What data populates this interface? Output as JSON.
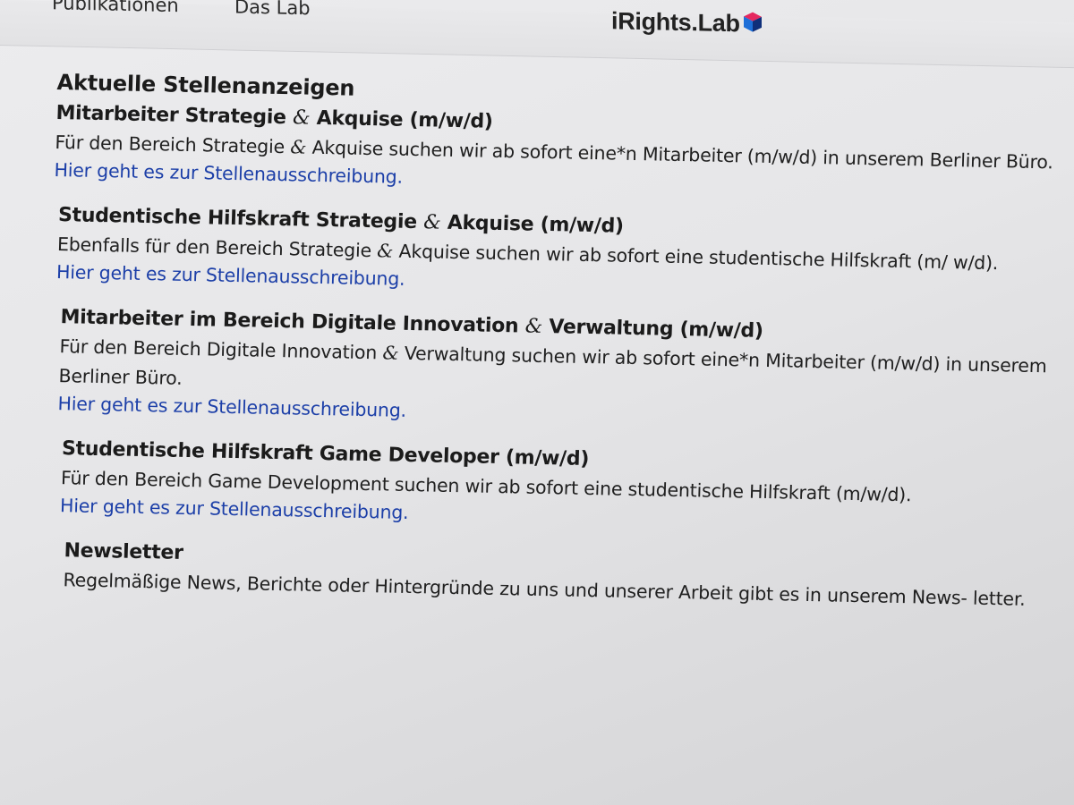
{
  "nav": {
    "items": [
      "Publikationen",
      "Das Lab"
    ],
    "logo_text": "iRights.Lab"
  },
  "section_title": "Aktuelle Stellenanzeigen",
  "jobs": [
    {
      "title_a": "Mitarbeiter Strategie ",
      "amp": "&",
      "title_b": " Akquise (m/w/d)",
      "desc_a": "Für den Bereich Strategie ",
      "desc_amp": "&",
      "desc_b": " Akquise suchen wir ab sofort eine*n Mitarbeiter (m/w/d) in unserem Berliner Büro.",
      "link": "Hier geht es zur Stellenausschreibung."
    },
    {
      "title_a": "Studentische Hilfskraft Strategie ",
      "amp": "&",
      "title_b": " Akquise (m/w/d)",
      "desc_a": "Ebenfalls für den Bereich Strategie ",
      "desc_amp": "&",
      "desc_b": " Akquise suchen wir ab sofort eine studentische Hilfskraft (m/ w/d).",
      "link": "Hier geht es zur Stellenausschreibung."
    },
    {
      "title_a": "Mitarbeiter im Bereich Digitale Innovation ",
      "amp": "&",
      "title_b": " Verwaltung (m/w/d)",
      "desc_a": "Für den Bereich Digitale Innovation ",
      "desc_amp": "&",
      "desc_b": " Verwaltung suchen wir ab sofort eine*n Mitarbeiter (m/w/d) in unserem Berliner Büro.",
      "link": "Hier geht es zur Stellenausschreibung."
    },
    {
      "title_a": "Studentische Hilfskraft Game Developer (m/w/d)",
      "amp": "",
      "title_b": "",
      "desc_a": "Für den Bereich Game Development suchen wir ab sofort eine studentische Hilfskraft (m/w/d).",
      "desc_amp": "",
      "desc_b": "",
      "link": "Hier geht es zur Stellenausschreibung."
    }
  ],
  "newsletter": {
    "title": "Newsletter",
    "text": "Regelmäßige News, Berichte oder Hintergründe zu uns und unserer Arbeit gibt es in unserem News- letter."
  }
}
